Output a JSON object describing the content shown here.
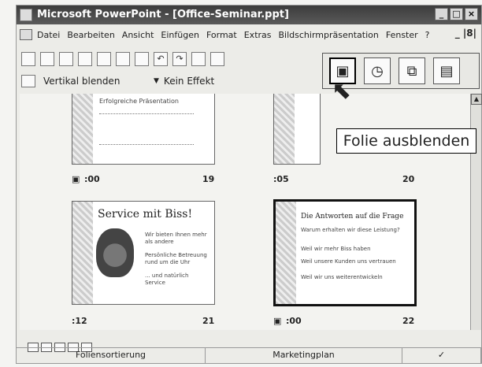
{
  "window": {
    "title": "Microsoft PowerPoint - [Office-Seminar.ppt]"
  },
  "window_buttons": [
    "_",
    "□",
    "×"
  ],
  "menu": {
    "items": [
      "Datei",
      "Bearbeiten",
      "Ansicht",
      "Einfügen",
      "Format",
      "Extras",
      "Bildschirmpräsentation",
      "Fenster",
      "?"
    ],
    "mdi_controls": "_ |8|"
  },
  "toolbar2": {
    "transition": "Vertikal blenden",
    "effect": "Kein Effekt"
  },
  "slides": [
    {
      "number": "19",
      "timing": ":00",
      "has_note_icon": true,
      "hidden_title": "Erfolgreiche Präsentation"
    },
    {
      "number": "20",
      "timing": ":05",
      "has_note_icon": false
    },
    {
      "number": "21",
      "timing": ":12",
      "has_note_icon": false,
      "title": "Service mit Biss!",
      "bullets": [
        "Wir bieten Ihnen mehr als andere",
        "Persönliche Betreuung rund um die Uhr",
        "... und natürlich Service"
      ]
    },
    {
      "number": "22",
      "timing": ":00",
      "has_note_icon": true,
      "title": "Die Antworten auf die Frage",
      "bullets": [
        "Warum erhalten wir diese Leistung?",
        "Weil wir mehr Biss haben",
        "Weil unsere Kunden uns vertrauen",
        "Weil wir uns weiterentwickeln"
      ]
    }
  ],
  "popup": {
    "tooltip": "Folie ausblenden"
  },
  "statusbar": {
    "view": "Foliensortierung",
    "design": "Marketingplan"
  }
}
